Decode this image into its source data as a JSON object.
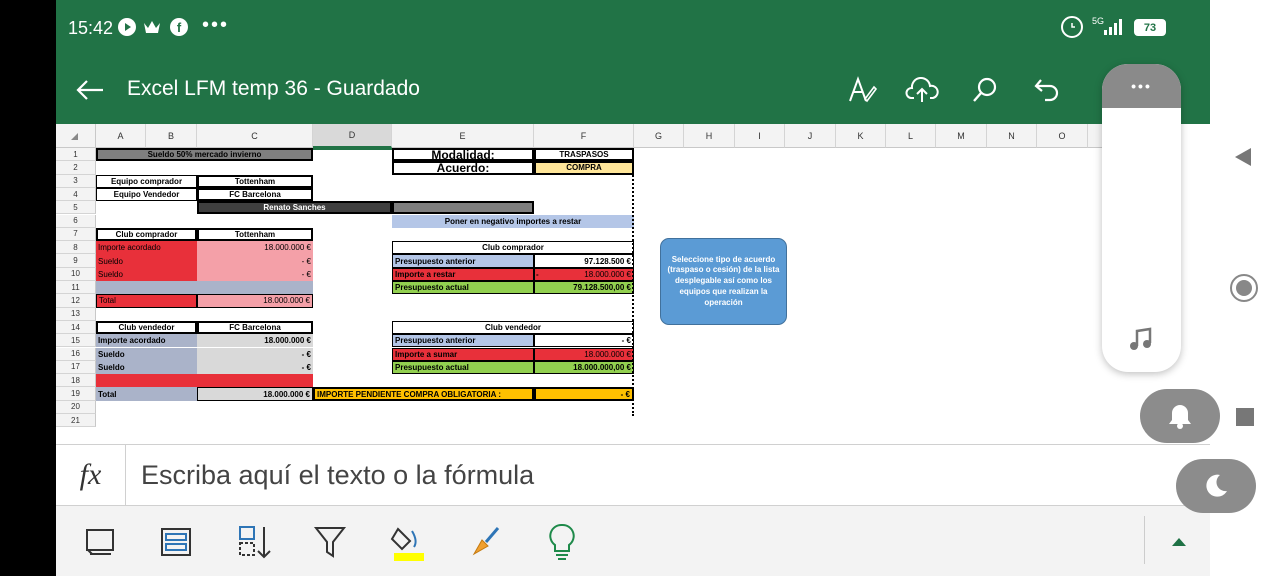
{
  "status": {
    "time": "15:42",
    "network": "5G",
    "battery": "73"
  },
  "header": {
    "title": "Excel LFM  temp 36 - Guardado"
  },
  "columns": [
    "A",
    "B",
    "C",
    "D",
    "E",
    "F",
    "G",
    "H",
    "I",
    "J",
    "K",
    "L",
    "M",
    "N",
    "O",
    "P",
    "F"
  ],
  "rows": [
    "1",
    "2",
    "3",
    "4",
    "5",
    "6",
    "7",
    "8",
    "9",
    "10",
    "11",
    "12",
    "13",
    "14",
    "15",
    "16",
    "17",
    "18",
    "19",
    "20",
    "21"
  ],
  "sheet": {
    "title": "Sueldo 50% mercado invierno",
    "equipo_comprador_label": "Equipo comprador",
    "equipo_comprador": "Tottenham",
    "equipo_vendedor_label": "Equipo Vendedor",
    "equipo_vendedor": "FC Barcelona",
    "player": "Renato Sanches",
    "modalidad_label": "Modalidad:",
    "modalidad": "TRASPASOS",
    "acuerdo_label": "Acuerdo:",
    "acuerdo": "COMPRA",
    "negativo": "Poner en negativo importes a restar",
    "club_comprador_label": "Club comprador",
    "club_comprador": "Tottenham",
    "importe_acordado": "Importe acordado",
    "importe_acordado_val": "18.000.000  €",
    "sueldo": "Sueldo",
    "sueldo_val": "-      €",
    "total": "Total",
    "total_val": "18.000.000  €",
    "club_vendedor_label": "Club vendedor",
    "club_vendedor": "FC Barcelona",
    "vend_importe_val": "18.000.000  €",
    "vend_sueldo_val": "-      €",
    "vend_total_val": "18.000.000  €",
    "comp_box": {
      "title": "Club comprador",
      "pres_ant": "Presupuesto anterior",
      "pres_ant_val": "97.128.500  €",
      "importe_restar": "Importe a restar",
      "importe_restar_dash": "-",
      "importe_restar_val": "18.000.000  €",
      "pres_act": "Presupuesto actual",
      "pres_act_val": "79.128.500,00 €"
    },
    "vend_box": {
      "title": "Club vendedor",
      "pres_ant": "Presupuesto anterior",
      "pres_ant_val": "-      €",
      "importe_sumar": "Importe a sumar",
      "importe_sumar_val": "18.000.000  €",
      "pres_act": "Presupuesto actual",
      "pres_act_val": "18.000.000,00 €"
    },
    "pendiente_label": "IMPORTE PENDIENTE COMPRA OBLIGATORIA :",
    "pendiente_val": "-      €",
    "note": "Seleccione tipo de acuerdo (traspaso o cesión) de la lista desplegable así como los equipos que realizan la operación"
  },
  "formula": {
    "fx": "fx",
    "placeholder": "Escriba aquí el texto o la fórmula"
  },
  "colors": {
    "excel_green": "#217346",
    "header_gray": "#7f7f7f",
    "dark_gray": "#3f3f3f",
    "red": "#e8303a",
    "pink": "#f4a0a8",
    "blue_gray": "#aab3c9",
    "light_blue": "#b4c6e7",
    "green": "#92d050",
    "orange": "#ffc000",
    "yellow": "#ffe699",
    "note_blue": "#5b9bd5"
  }
}
